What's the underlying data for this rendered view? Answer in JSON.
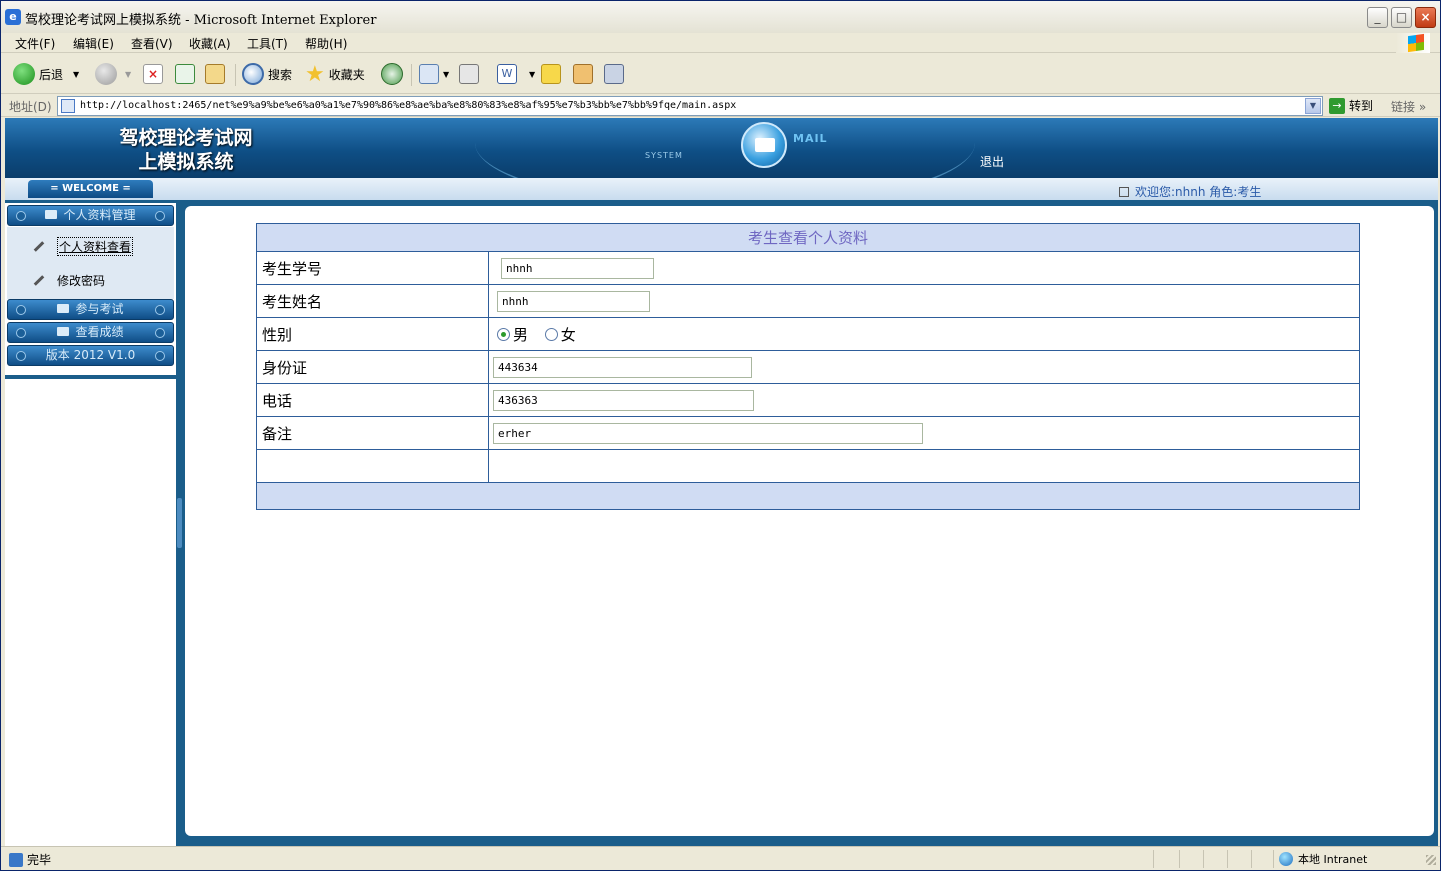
{
  "window": {
    "title": "驾校理论考试网上模拟系统 - Microsoft Internet Explorer",
    "minimize": "_",
    "maximize": "□",
    "close": "×"
  },
  "menu": [
    "文件(F)",
    "编辑(E)",
    "查看(V)",
    "收藏(A)",
    "工具(T)",
    "帮助(H)"
  ],
  "toolbar": {
    "back": "后退",
    "search": "搜索",
    "favorites": "收藏夹"
  },
  "address": {
    "label": "地址(D)",
    "url": "http://localhost:2465/net%e9%a9%be%e6%a0%a1%e7%90%86%e8%ae%ba%e8%80%83%e8%af%95%e7%b3%bb%e7%bb%9fqe/main.aspx",
    "go": "转到",
    "links": "链接"
  },
  "header": {
    "site_title_line1": "驾校理论考试网",
    "site_title_line2": "上模拟系统",
    "system_label": "SYSTEM",
    "mail_label": "MAIL",
    "logout": "退出"
  },
  "welcome": {
    "tab": "= WELCOME =",
    "user_text": "欢迎您:nhnh 角色:考生"
  },
  "sidebar": {
    "sections": [
      {
        "label": "个人资料管理"
      },
      {
        "label": "参与考试"
      },
      {
        "label": "查看成绩"
      },
      {
        "label": "版本 2012 V1.0"
      }
    ],
    "items": [
      {
        "label": "个人资料查看"
      },
      {
        "label": "修改密码"
      }
    ]
  },
  "form": {
    "caption": "考生查看个人资料",
    "rows": [
      {
        "label": "考生学号",
        "value": "nhnh"
      },
      {
        "label": "考生姓名",
        "value": "nhnh"
      },
      {
        "label": "性别",
        "options": [
          "男",
          "女"
        ],
        "selected": "男"
      },
      {
        "label": "身份证",
        "value": "443634"
      },
      {
        "label": "电话",
        "value": "436363"
      },
      {
        "label": "备注",
        "value": "erher"
      }
    ]
  },
  "status": {
    "text": "完毕",
    "zone": "本地 Intranet"
  },
  "colors": {
    "header_blue": "#0f4f86",
    "table_border": "#2e5d9a",
    "caption_bg": "#d0dcf3",
    "caption_text": "#6f67c2"
  }
}
